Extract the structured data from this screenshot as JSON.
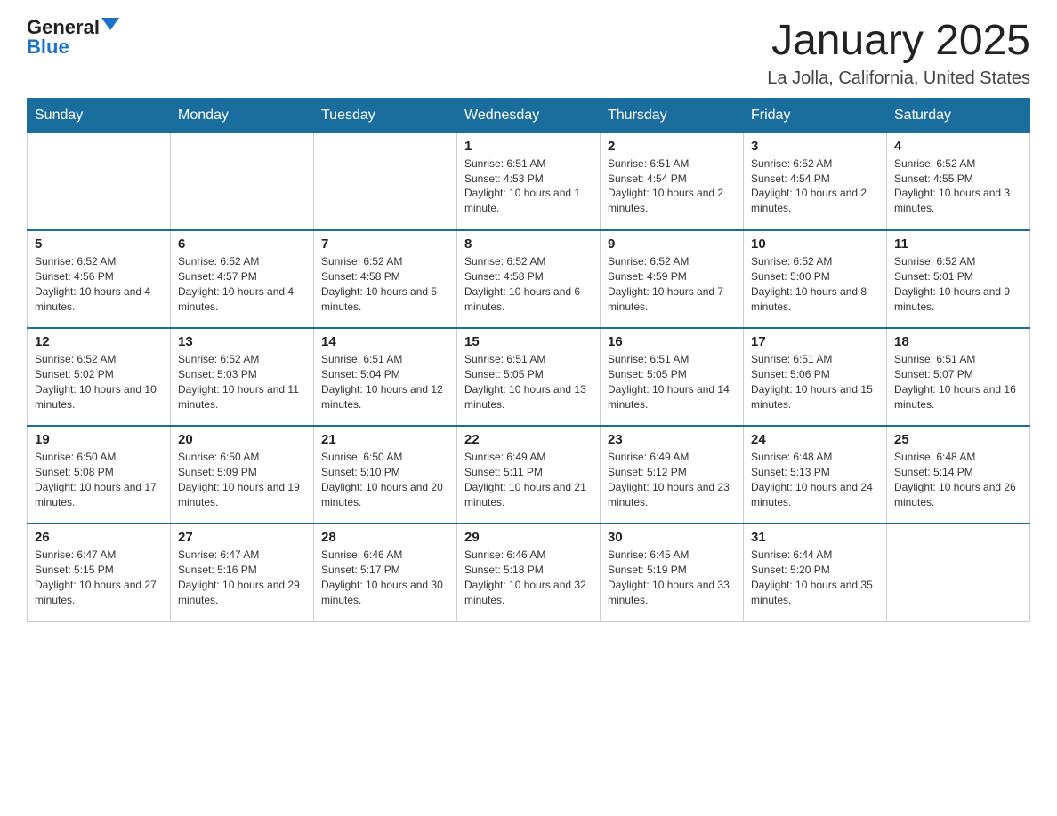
{
  "logo": {
    "general": "General",
    "blue": "Blue"
  },
  "title": "January 2025",
  "subtitle": "La Jolla, California, United States",
  "days_of_week": [
    "Sunday",
    "Monday",
    "Tuesday",
    "Wednesday",
    "Thursday",
    "Friday",
    "Saturday"
  ],
  "weeks": [
    [
      {
        "day": "",
        "info": ""
      },
      {
        "day": "",
        "info": ""
      },
      {
        "day": "",
        "info": ""
      },
      {
        "day": "1",
        "info": "Sunrise: 6:51 AM\nSunset: 4:53 PM\nDaylight: 10 hours and 1 minute."
      },
      {
        "day": "2",
        "info": "Sunrise: 6:51 AM\nSunset: 4:54 PM\nDaylight: 10 hours and 2 minutes."
      },
      {
        "day": "3",
        "info": "Sunrise: 6:52 AM\nSunset: 4:54 PM\nDaylight: 10 hours and 2 minutes."
      },
      {
        "day": "4",
        "info": "Sunrise: 6:52 AM\nSunset: 4:55 PM\nDaylight: 10 hours and 3 minutes."
      }
    ],
    [
      {
        "day": "5",
        "info": "Sunrise: 6:52 AM\nSunset: 4:56 PM\nDaylight: 10 hours and 4 minutes."
      },
      {
        "day": "6",
        "info": "Sunrise: 6:52 AM\nSunset: 4:57 PM\nDaylight: 10 hours and 4 minutes."
      },
      {
        "day": "7",
        "info": "Sunrise: 6:52 AM\nSunset: 4:58 PM\nDaylight: 10 hours and 5 minutes."
      },
      {
        "day": "8",
        "info": "Sunrise: 6:52 AM\nSunset: 4:58 PM\nDaylight: 10 hours and 6 minutes."
      },
      {
        "day": "9",
        "info": "Sunrise: 6:52 AM\nSunset: 4:59 PM\nDaylight: 10 hours and 7 minutes."
      },
      {
        "day": "10",
        "info": "Sunrise: 6:52 AM\nSunset: 5:00 PM\nDaylight: 10 hours and 8 minutes."
      },
      {
        "day": "11",
        "info": "Sunrise: 6:52 AM\nSunset: 5:01 PM\nDaylight: 10 hours and 9 minutes."
      }
    ],
    [
      {
        "day": "12",
        "info": "Sunrise: 6:52 AM\nSunset: 5:02 PM\nDaylight: 10 hours and 10 minutes."
      },
      {
        "day": "13",
        "info": "Sunrise: 6:52 AM\nSunset: 5:03 PM\nDaylight: 10 hours and 11 minutes."
      },
      {
        "day": "14",
        "info": "Sunrise: 6:51 AM\nSunset: 5:04 PM\nDaylight: 10 hours and 12 minutes."
      },
      {
        "day": "15",
        "info": "Sunrise: 6:51 AM\nSunset: 5:05 PM\nDaylight: 10 hours and 13 minutes."
      },
      {
        "day": "16",
        "info": "Sunrise: 6:51 AM\nSunset: 5:05 PM\nDaylight: 10 hours and 14 minutes."
      },
      {
        "day": "17",
        "info": "Sunrise: 6:51 AM\nSunset: 5:06 PM\nDaylight: 10 hours and 15 minutes."
      },
      {
        "day": "18",
        "info": "Sunrise: 6:51 AM\nSunset: 5:07 PM\nDaylight: 10 hours and 16 minutes."
      }
    ],
    [
      {
        "day": "19",
        "info": "Sunrise: 6:50 AM\nSunset: 5:08 PM\nDaylight: 10 hours and 17 minutes."
      },
      {
        "day": "20",
        "info": "Sunrise: 6:50 AM\nSunset: 5:09 PM\nDaylight: 10 hours and 19 minutes."
      },
      {
        "day": "21",
        "info": "Sunrise: 6:50 AM\nSunset: 5:10 PM\nDaylight: 10 hours and 20 minutes."
      },
      {
        "day": "22",
        "info": "Sunrise: 6:49 AM\nSunset: 5:11 PM\nDaylight: 10 hours and 21 minutes."
      },
      {
        "day": "23",
        "info": "Sunrise: 6:49 AM\nSunset: 5:12 PM\nDaylight: 10 hours and 23 minutes."
      },
      {
        "day": "24",
        "info": "Sunrise: 6:48 AM\nSunset: 5:13 PM\nDaylight: 10 hours and 24 minutes."
      },
      {
        "day": "25",
        "info": "Sunrise: 6:48 AM\nSunset: 5:14 PM\nDaylight: 10 hours and 26 minutes."
      }
    ],
    [
      {
        "day": "26",
        "info": "Sunrise: 6:47 AM\nSunset: 5:15 PM\nDaylight: 10 hours and 27 minutes."
      },
      {
        "day": "27",
        "info": "Sunrise: 6:47 AM\nSunset: 5:16 PM\nDaylight: 10 hours and 29 minutes."
      },
      {
        "day": "28",
        "info": "Sunrise: 6:46 AM\nSunset: 5:17 PM\nDaylight: 10 hours and 30 minutes."
      },
      {
        "day": "29",
        "info": "Sunrise: 6:46 AM\nSunset: 5:18 PM\nDaylight: 10 hours and 32 minutes."
      },
      {
        "day": "30",
        "info": "Sunrise: 6:45 AM\nSunset: 5:19 PM\nDaylight: 10 hours and 33 minutes."
      },
      {
        "day": "31",
        "info": "Sunrise: 6:44 AM\nSunset: 5:20 PM\nDaylight: 10 hours and 35 minutes."
      },
      {
        "day": "",
        "info": ""
      }
    ]
  ]
}
